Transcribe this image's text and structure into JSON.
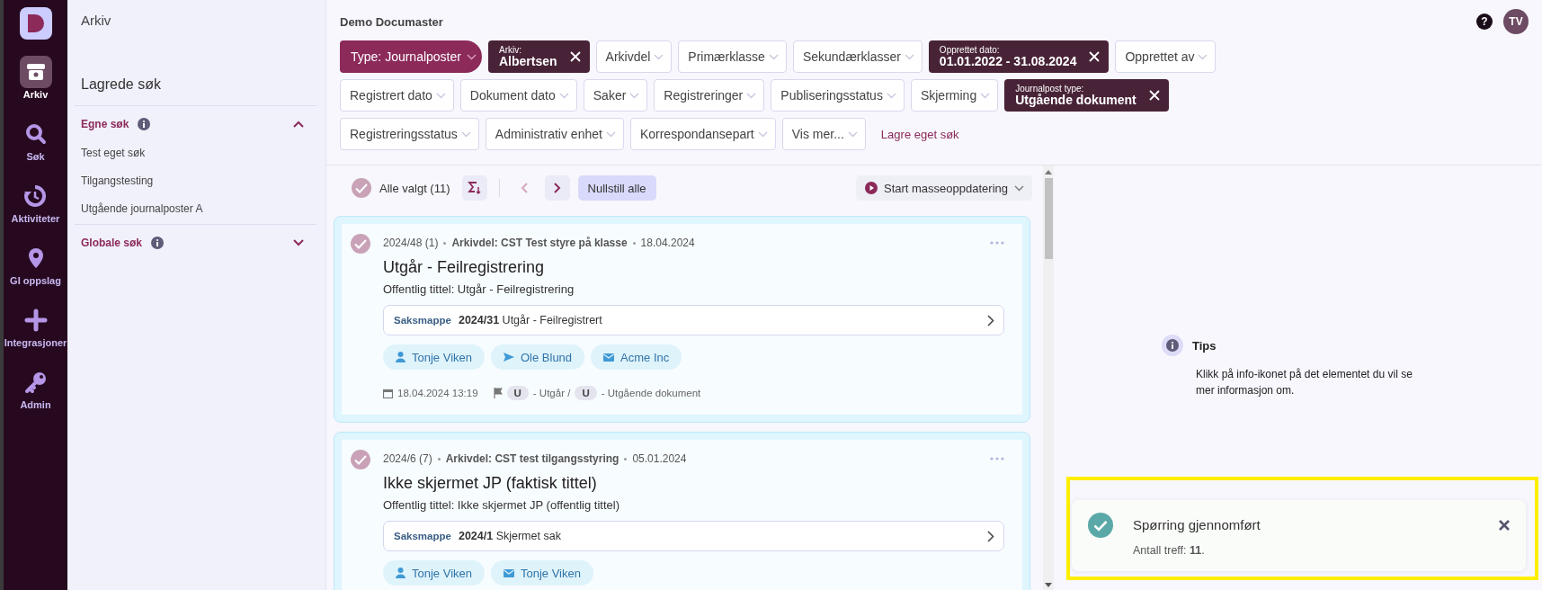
{
  "nav": {
    "items": [
      {
        "label": "Arkiv",
        "selected": true
      },
      {
        "label": "Søk",
        "selected": false
      },
      {
        "label": "Aktiviteter",
        "selected": false
      },
      {
        "label": "GI oppslag",
        "selected": false
      },
      {
        "label": "Integrasjoner",
        "selected": false
      },
      {
        "label": "Admin",
        "selected": false
      }
    ]
  },
  "side_panel": {
    "title": "Arkiv",
    "heading": "Lagrede søk",
    "groups": [
      {
        "label": "Egne søk",
        "expanded": true,
        "items": [
          "Test eget søk",
          "Tilgangstesting",
          "Utgående journalposter A"
        ]
      },
      {
        "label": "Globale søk",
        "expanded": false
      }
    ]
  },
  "header": {
    "title": "Demo Documaster",
    "help": "?",
    "avatar": "TV"
  },
  "filter_rows": [
    {
      "filters": [
        {
          "kind": "primary",
          "label": "Type: Journalposter"
        },
        {
          "kind": "active",
          "label": "Arkiv:",
          "value": "Albertsen"
        },
        {
          "kind": "plain",
          "label": "Arkivdel"
        },
        {
          "kind": "plain",
          "label": "Primærklasse"
        },
        {
          "kind": "plain",
          "label": "Sekundærklasser"
        },
        {
          "kind": "active",
          "label": "Opprettet dato:",
          "value": "01.01.2022 - 31.08.2024"
        },
        {
          "kind": "plain",
          "label": "Opprettet av"
        }
      ]
    },
    {
      "filters": [
        {
          "kind": "plain",
          "label": "Registrert dato"
        },
        {
          "kind": "plain",
          "label": "Dokument dato"
        },
        {
          "kind": "plain",
          "label": "Saker"
        },
        {
          "kind": "plain",
          "label": "Registreringer"
        },
        {
          "kind": "plain",
          "label": "Publiseringsstatus"
        },
        {
          "kind": "plain",
          "label": "Skjerming"
        },
        {
          "kind": "active",
          "label": "Journalpost type:",
          "value": "Utgående dokument"
        }
      ]
    },
    {
      "filters": [
        {
          "kind": "plain",
          "label": "Registreringsstatus"
        },
        {
          "kind": "plain",
          "label": "Administrativ enhet"
        },
        {
          "kind": "plain",
          "label": "Korrespondansepart"
        },
        {
          "kind": "plain",
          "label": "Vis mer..."
        }
      ]
    }
  ],
  "save_search": "Lagre eget søk",
  "toolbar": {
    "select_all": {
      "label": "Alle valgt (11)",
      "checked": true
    },
    "reset": "Nullstill alle",
    "mass_update": "Start masseoppdatering"
  },
  "cards": [
    {
      "selected": true,
      "number": "2024/48 (1)",
      "arkivdel": "Arkivdel: CST Test styre på klasse",
      "date": "18.04.2024",
      "title": "Utgår - Feilregistrering",
      "public_title": "Offentlig tittel: Utgår - Feilregistrering",
      "case_label": "Saksmappe",
      "case_value": "**2024/31** Utgår - Feilregistrert",
      "parties": [
        {
          "kind": "person",
          "name": "Tonje Viken"
        },
        {
          "kind": "sender",
          "name": "Ole Blund"
        },
        {
          "kind": "recipient",
          "name": "Acme Inc"
        }
      ],
      "footer": {
        "datetime": "18.04.2024 13:19",
        "status_code": "U",
        "status": "- Utgår /",
        "type_code": "U",
        "type": "- Utgående dokument"
      }
    },
    {
      "selected": true,
      "number": "2024/6 (7)",
      "arkivdel": "Arkivdel: CST test tilgangsstyring",
      "date": "05.01.2024",
      "title": "Ikke skjermet JP (faktisk tittel)",
      "public_title": "Offentlig tittel: Ikke skjermet JP (offentlig tittel)",
      "case_label": "Saksmappe",
      "case_value": "**2024/1** Skjermet sak",
      "parties": [
        {
          "kind": "person",
          "name": "Tonje Viken"
        },
        {
          "kind": "recipient",
          "name": "Tonje Viken"
        }
      ]
    }
  ],
  "tips": {
    "title": "Tips",
    "text": "Klikk på info-ikonet på det elementet du vil se mer informasjon om."
  },
  "toast": {
    "title": "Spørring gjennomført",
    "text": "Antall treff: **11**."
  }
}
